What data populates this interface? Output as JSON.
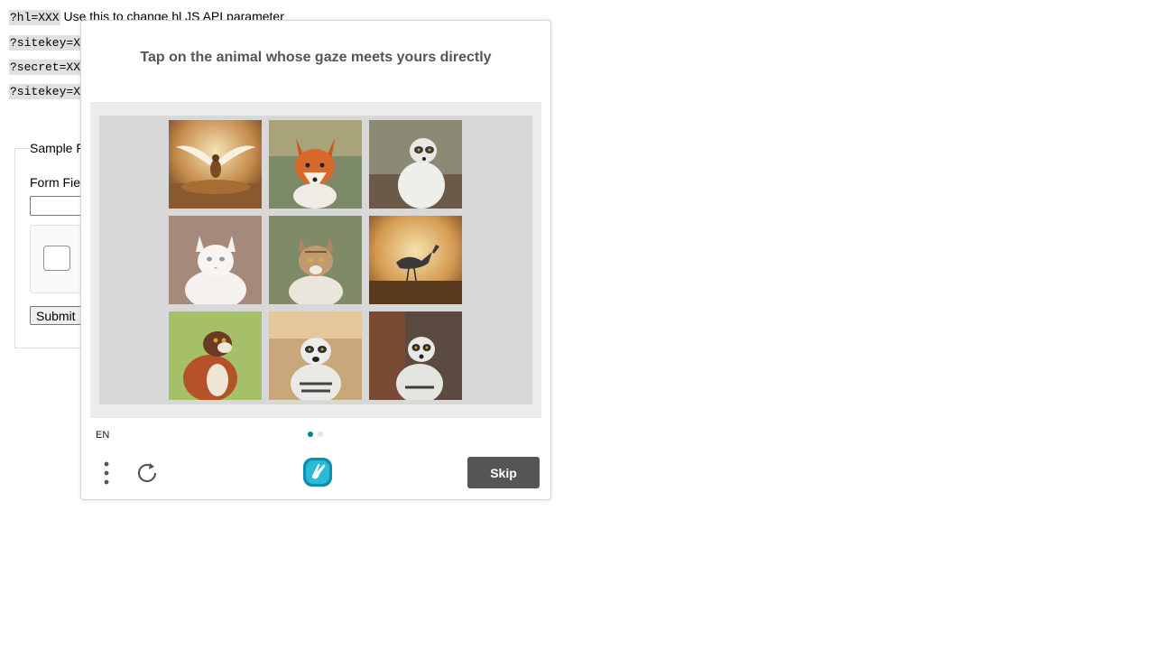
{
  "page": {
    "params": [
      {
        "code": "?hl=XXX",
        "text": " Use this to change hl JS API parameter"
      },
      {
        "code": "?sitekey=X",
        "text": ""
      },
      {
        "code": "?secret=XX",
        "text": ""
      },
      {
        "code": "?sitekey=X",
        "text": ""
      }
    ],
    "form_legend": "Sample F",
    "field_label": "Form Fie",
    "submit_label": "Submit"
  },
  "challenge": {
    "prompt": "Tap on the animal whose gaze meets yours directly",
    "tiles": [
      {
        "icon": "bird-wings-spread-image"
      },
      {
        "icon": "fox-image"
      },
      {
        "icon": "lemur-image"
      },
      {
        "icon": "white-cat-image"
      },
      {
        "icon": "tabby-cat-image"
      },
      {
        "icon": "bird-silhouette-image"
      },
      {
        "icon": "red-lemur-image"
      },
      {
        "icon": "lemur-image"
      },
      {
        "icon": "lemur-image"
      }
    ],
    "pages": {
      "current": 1,
      "total": 2
    },
    "language": "EN",
    "skip_label": "Skip",
    "colors": {
      "accent": "#00838f",
      "skip_button": "#555555",
      "prompt_text": "#555555"
    }
  }
}
